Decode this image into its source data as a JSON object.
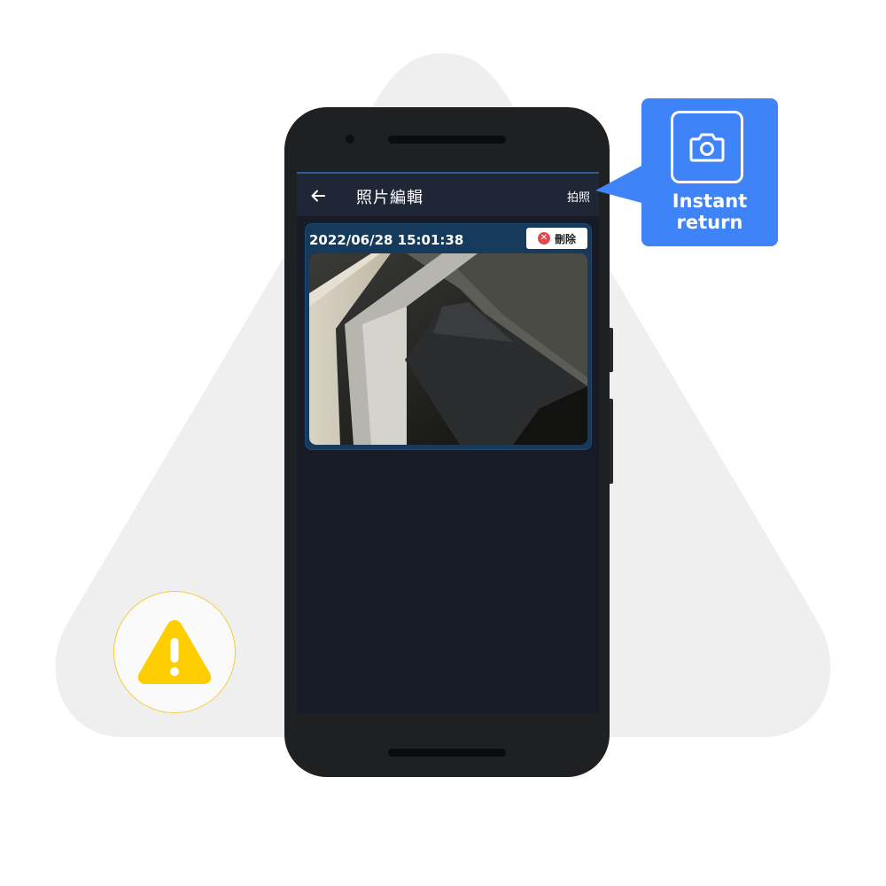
{
  "app": {
    "title": "照片編輯",
    "action_label": "拍照",
    "back_icon": "arrow-left-icon"
  },
  "photo_card": {
    "timestamp": "2022/06/28 15:01:38",
    "delete_label": "刪除",
    "delete_icon": "close-circle-icon"
  },
  "callout": {
    "icon": "camera-icon",
    "text_line1": "Instant",
    "text_line2": "return",
    "color": "#3f83f8"
  },
  "badges": {
    "warning_icon": "warning-triangle-icon",
    "warning_color": "#ffce00"
  },
  "colors": {
    "screen_bg": "#161b27",
    "appbar_bg": "#1f2636",
    "card_bg": "#163a5c",
    "delete_icon": "#e04a4a"
  }
}
